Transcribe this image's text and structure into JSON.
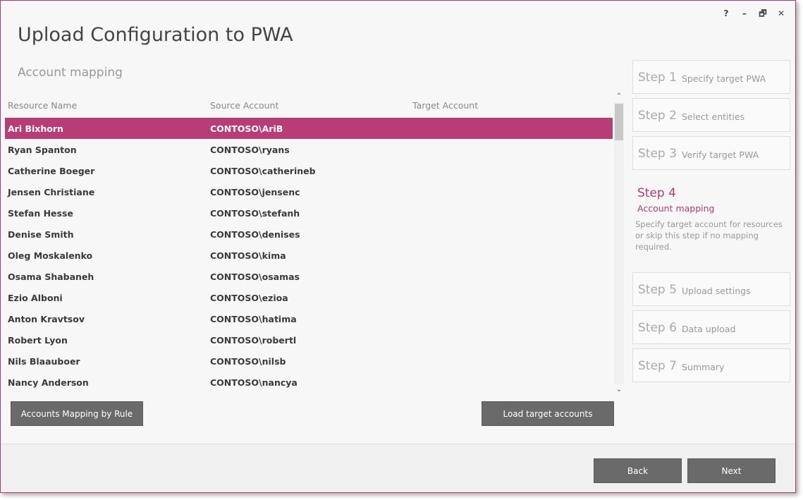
{
  "window": {
    "title": "Upload Configuration to PWA",
    "section": "Account mapping",
    "controls": {
      "help": "?",
      "minimize": "–",
      "restore": "🗗",
      "close": "✕"
    }
  },
  "grid": {
    "columns": [
      "Resource Name",
      "Source Account",
      "Target Account"
    ],
    "rows": [
      {
        "name": "Ari Bixhorn",
        "source": "CONTOSO\\AriB",
        "target": ""
      },
      {
        "name": "Ryan Spanton",
        "source": "CONTOSO\\ryans",
        "target": ""
      },
      {
        "name": "Catherine Boeger",
        "source": "CONTOSO\\catherineb",
        "target": ""
      },
      {
        "name": "Jensen Christiane",
        "source": "CONTOSO\\jensenc",
        "target": ""
      },
      {
        "name": "Stefan Hesse",
        "source": "CONTOSO\\stefanh",
        "target": ""
      },
      {
        "name": "Denise Smith",
        "source": "CONTOSO\\denises",
        "target": ""
      },
      {
        "name": "Oleg Moskalenko",
        "source": "CONTOSO\\kima",
        "target": ""
      },
      {
        "name": "Osama Shabaneh",
        "source": "CONTOSO\\osamas",
        "target": ""
      },
      {
        "name": "Ezio Alboni",
        "source": "CONTOSO\\ezioa",
        "target": ""
      },
      {
        "name": "Anton Kravtsov",
        "source": "CONTOSO\\hatima",
        "target": ""
      },
      {
        "name": "Robert Lyon",
        "source": "CONTOSO\\robertl",
        "target": ""
      },
      {
        "name": "Nils Blaauboer",
        "source": "CONTOSO\\nilsb",
        "target": ""
      },
      {
        "name": "Nancy Anderson",
        "source": "CONTOSO\\nancya",
        "target": ""
      }
    ],
    "selected_index": 0
  },
  "buttons": {
    "mapping_by_rule": "Accounts Mapping by Rule",
    "load_target": "Load target accounts",
    "back": "Back",
    "next": "Next"
  },
  "steps": [
    {
      "num": "Step 1",
      "label": "Specify target PWA"
    },
    {
      "num": "Step 2",
      "label": "Select entities"
    },
    {
      "num": "Step 3",
      "label": "Verify target PWA"
    },
    {
      "num": "Step 4",
      "label": "Account mapping",
      "desc": "Specify target account for resources or skip this step if no mapping required."
    },
    {
      "num": "Step 5",
      "label": "Upload settings"
    },
    {
      "num": "Step 6",
      "label": "Data upload"
    },
    {
      "num": "Step 7",
      "label": "Summary"
    }
  ],
  "colors": {
    "accent": "#b03a78",
    "selected_row": "#b83d76",
    "button": "#6a6a6a"
  }
}
